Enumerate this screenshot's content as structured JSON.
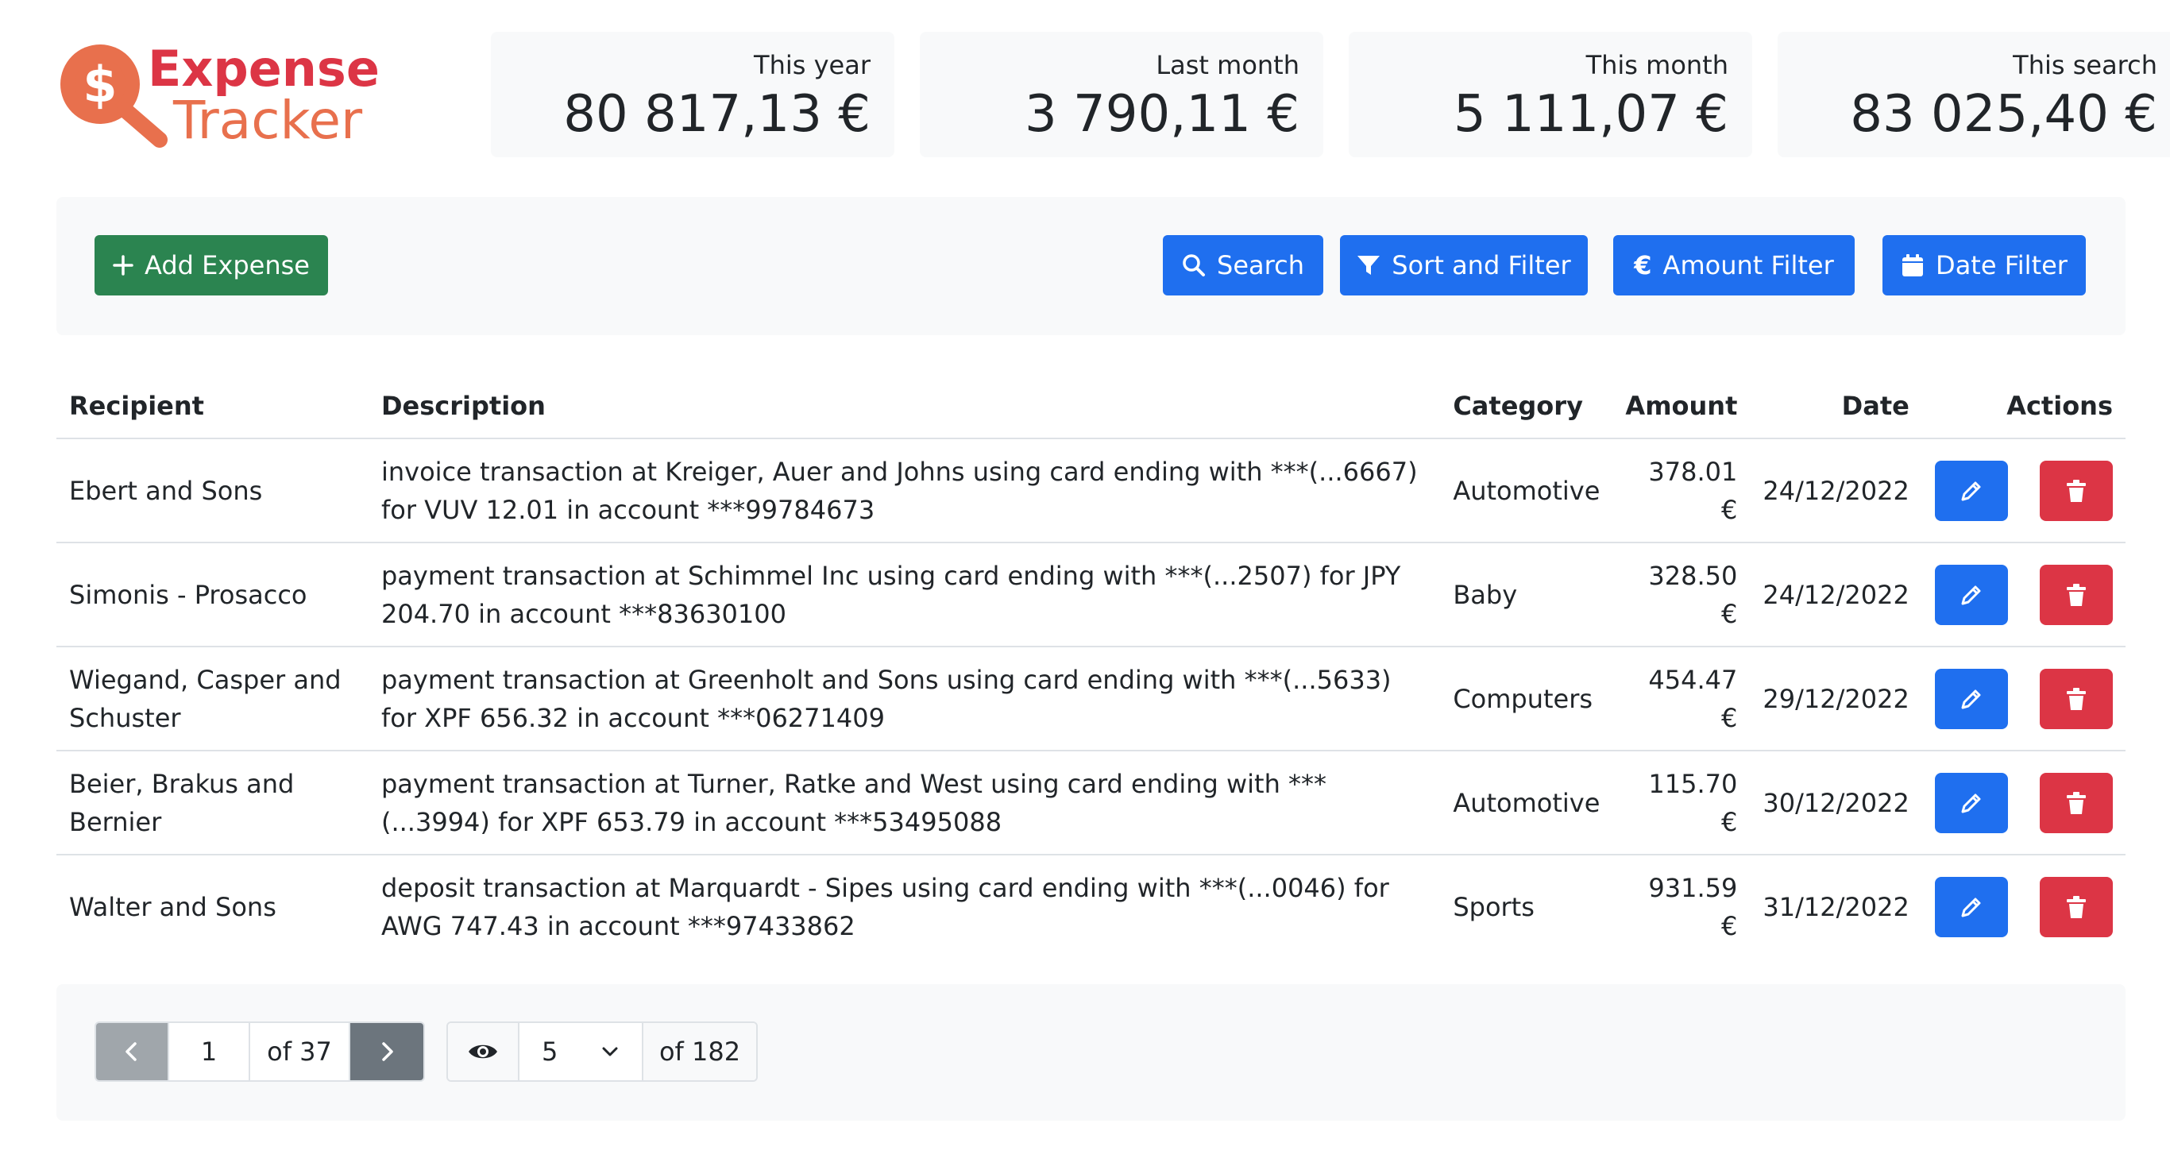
{
  "app": {
    "logo_line1": "Expense",
    "logo_line2": "Tracker",
    "brand_color": "#e8704d"
  },
  "stats": [
    {
      "label": "This year",
      "value": "80 817,13 €"
    },
    {
      "label": "Last month",
      "value": "3 790,11 €"
    },
    {
      "label": "This month",
      "value": "5 111,07 €"
    },
    {
      "label": "This search",
      "value": "83 025,40 €"
    }
  ],
  "toolbar": {
    "add_label": "Add Expense",
    "search_label": "Search",
    "sort_filter_label": "Sort and Filter",
    "amount_filter_label": "Amount Filter",
    "date_filter_label": "Date Filter"
  },
  "table": {
    "headers": {
      "recipient": "Recipient",
      "description": "Description",
      "category": "Category",
      "amount": "Amount",
      "date": "Date",
      "actions": "Actions"
    },
    "rows": [
      {
        "recipient": "Ebert and Sons",
        "description": "invoice transaction at Kreiger, Auer and Johns using card ending with ***(...6667) for VUV 12.01 in account ***99784673",
        "category": "Automotive",
        "amount": "378.01 €",
        "date": "24/12/2022"
      },
      {
        "recipient": "Simonis - Prosacco",
        "description": "payment transaction at Schimmel Inc using card ending with ***(...2507) for JPY 204.70 in account ***83630100",
        "category": "Baby",
        "amount": "328.50 €",
        "date": "24/12/2022"
      },
      {
        "recipient": "Wiegand, Casper and Schuster",
        "description": "payment transaction at Greenholt and Sons using card ending with ***(...5633) for XPF 656.32 in account ***06271409",
        "category": "Computers",
        "amount": "454.47 €",
        "date": "29/12/2022"
      },
      {
        "recipient": "Beier, Brakus and Bernier",
        "description": "payment transaction at Turner, Ratke and West using card ending with ***(...3994) for XPF 653.79 in account ***53495088",
        "category": "Automotive",
        "amount": "115.70 €",
        "date": "30/12/2022"
      },
      {
        "recipient": "Walter and Sons",
        "description": "deposit transaction at Marquardt - Sipes using card ending with ***(...0046) for AWG 747.43 in account ***97433862",
        "category": "Sports",
        "amount": "931.59 €",
        "date": "31/12/2022"
      }
    ]
  },
  "pagination": {
    "current_page": "1",
    "total_pages": "of 37",
    "page_size": "5",
    "total_items": "of 182"
  },
  "colors": {
    "primary": "#1f6fef",
    "success": "#2b8450",
    "danger": "#dc3545",
    "secondary": "#6c757d"
  }
}
